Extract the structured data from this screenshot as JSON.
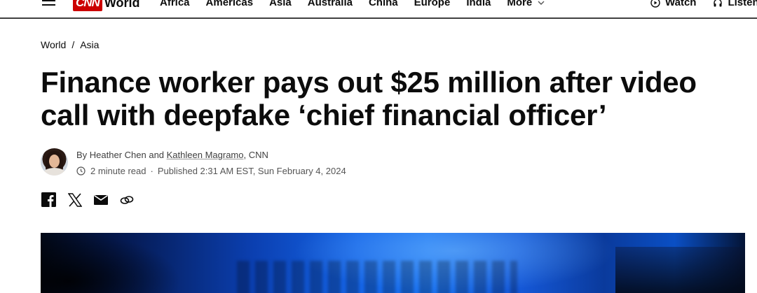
{
  "header": {
    "logo_brand": "CNN",
    "logo_section": "World",
    "nav": [
      "Africa",
      "Americas",
      "Asia",
      "Australia",
      "China",
      "Europe",
      "India"
    ],
    "more_label": "More",
    "watch_label": "Watch",
    "listen_label": "Listen"
  },
  "breadcrumb": [
    "World",
    "Asia"
  ],
  "article": {
    "headline": "Finance worker pays out $25 million after video call with deepfake ‘chief financial officer’",
    "byline_prefix": "By Heather Chen and ",
    "byline_link": "Kathleen Magramo",
    "byline_suffix": ", CNN",
    "read_time": "2 minute read",
    "published": "Published 2:31 AM EST, Sun February 4, 2024"
  },
  "share_icons": [
    "facebook-icon",
    "x-icon",
    "email-icon",
    "link-icon"
  ],
  "colors": {
    "brand_red": "#cc0000",
    "text": "#0c0c0c",
    "muted": "#555555"
  }
}
